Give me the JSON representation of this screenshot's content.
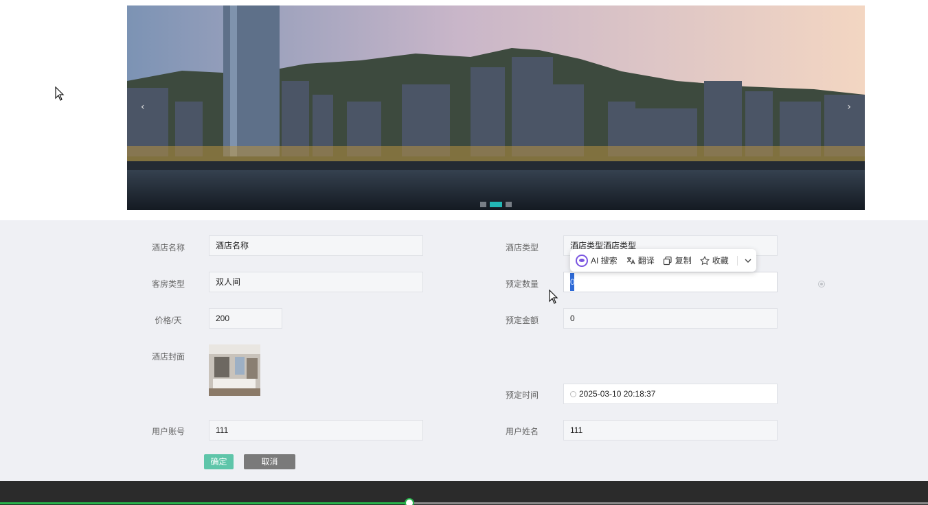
{
  "banner": {
    "dots": [
      {
        "active": false
      },
      {
        "active": true
      },
      {
        "active": false
      }
    ],
    "prev_arrow": "‹",
    "next_arrow": "›"
  },
  "form": {
    "hotel_name": {
      "label": "酒店名称",
      "value": "酒店名称"
    },
    "hotel_type": {
      "label": "酒店类型",
      "value": "酒店类型酒店类型"
    },
    "room_type": {
      "label": "客房类型",
      "value": "双人间"
    },
    "booking_qty": {
      "label": "预定数量",
      "value": "0"
    },
    "price_per_day": {
      "label": "价格/天",
      "value": "200"
    },
    "booking_amount": {
      "label": "预定金额",
      "value": "0"
    },
    "hotel_cover": {
      "label": "酒店封面"
    },
    "booking_time": {
      "label": "预定时间",
      "value": "2025-03-10 20:18:37"
    },
    "user_account": {
      "label": "用户账号",
      "value": "111"
    },
    "user_name": {
      "label": "用户姓名",
      "value": "111"
    },
    "confirm_label": "确定",
    "cancel_label": "取消"
  },
  "ai_toolbar": {
    "search_label": "AI 搜索",
    "translate_label": "翻译",
    "copy_label": "复制",
    "favorite_label": "收藏"
  },
  "player": {
    "progress_fraction": 0.441
  },
  "colors": {
    "accent": "#22b8b6",
    "confirm": "#5ec5a9",
    "cancel": "#7a7a7a",
    "progress": "#27b34b"
  }
}
